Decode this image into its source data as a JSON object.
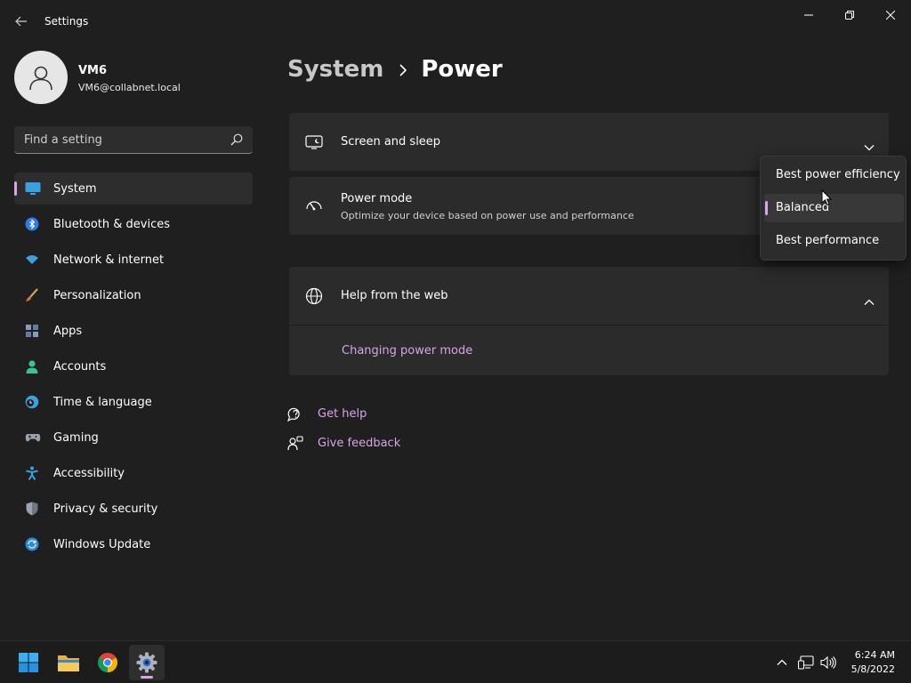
{
  "window": {
    "title": "Settings",
    "controls": [
      "minimize-icon",
      "restore-icon",
      "close-icon"
    ]
  },
  "profile": {
    "name": "VM6",
    "email": "VM6@collabnet.local"
  },
  "search": {
    "placeholder": "Find a setting",
    "value": ""
  },
  "sidebar": {
    "items": [
      {
        "label": "System",
        "icon": "monitor-icon",
        "active": true
      },
      {
        "label": "Bluetooth & devices",
        "icon": "bluetooth-icon"
      },
      {
        "label": "Network & internet",
        "icon": "wifi-icon"
      },
      {
        "label": "Personalization",
        "icon": "brush-icon"
      },
      {
        "label": "Apps",
        "icon": "apps-icon"
      },
      {
        "label": "Accounts",
        "icon": "person-icon"
      },
      {
        "label": "Time & language",
        "icon": "clock-globe-icon"
      },
      {
        "label": "Gaming",
        "icon": "gamepad-icon"
      },
      {
        "label": "Accessibility",
        "icon": "accessibility-icon"
      },
      {
        "label": "Privacy & security",
        "icon": "shield-icon"
      },
      {
        "label": "Windows Update",
        "icon": "update-icon"
      }
    ]
  },
  "breadcrumb": {
    "parent": "System",
    "separator": "›",
    "current": "Power"
  },
  "cards": {
    "screen_sleep": {
      "title": "Screen and sleep",
      "icon": "screen-sleep-icon"
    },
    "power_mode": {
      "title": "Power mode",
      "subtitle": "Optimize your device based on power use and performance",
      "icon": "power-mode-icon"
    },
    "help_web": {
      "title": "Help from the web",
      "icon": "globe-icon",
      "link": "Changing power mode"
    }
  },
  "dropdown": {
    "options": [
      "Best power efficiency",
      "Balanced",
      "Best performance"
    ],
    "selected": "Balanced"
  },
  "footer_links": {
    "get_help": "Get help",
    "give_feedback": "Give feedback"
  },
  "taskbar": {
    "apps": [
      "start-icon",
      "file-explorer-icon",
      "chrome-icon",
      "settings-icon"
    ],
    "active_app": "settings-icon",
    "tray_icons": [
      "chevron-up-icon",
      "network-icon",
      "volume-icon"
    ],
    "time": "6:24 AM",
    "date": "5/8/2022"
  },
  "colors": {
    "background": "#1f1f1f",
    "card": "#2b2b2b",
    "accent": "#d6a6e8",
    "taskbar": "#1c1c1c"
  }
}
